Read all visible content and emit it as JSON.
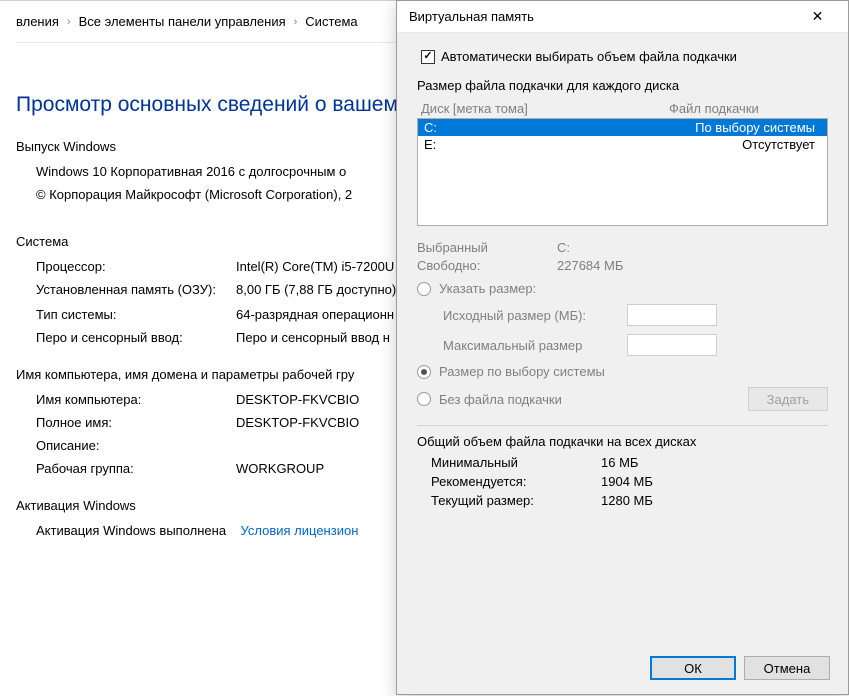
{
  "breadcrumbs": {
    "item0": "вления",
    "item1": "Все элементы панели управления",
    "item2": "Система"
  },
  "heading": "Просмотр основных сведений о вашем ко",
  "edition": {
    "label": "Выпуск Windows",
    "name": "Windows 10 Корпоративная 2016 с долгосрочным о",
    "copyright": "© Корпорация Майкрософт (Microsoft Corporation), 2"
  },
  "system": {
    "label": "Система",
    "cpu_k": "Процессор:",
    "cpu_v": "Intel(R) Core(TM) i5-7200U",
    "ram_k": "Установленная память (ОЗУ):",
    "ram_v": "8,00 ГБ (7,88 ГБ доступно)",
    "type_k": "Тип системы:",
    "type_v": "64-разрядная операционн",
    "pen_k": "Перо и сенсорный ввод:",
    "pen_v": "Перо и сенсорный ввод н"
  },
  "computer": {
    "label": "Имя компьютера, имя домена и параметры рабочей гру",
    "name_k": "Имя компьютера:",
    "name_v": "DESKTOP-FKVCBIO",
    "full_k": "Полное имя:",
    "full_v": "DESKTOP-FKVCBIO",
    "desc_k": "Описание:",
    "desc_v": "",
    "wg_k": "Рабочая группа:",
    "wg_v": "WORKGROUP"
  },
  "activation": {
    "label": "Активация Windows",
    "status": "Активация Windows выполнена",
    "link": "Условия лицензион"
  },
  "dialog": {
    "title": "Виртуальная память",
    "auto": "Автоматически выбирать объем файла подкачки",
    "group_per_drive": "Размер файла подкачки для каждого диска",
    "hdr_drive": "Диск [метка тома]",
    "hdr_file": "Файл подкачки",
    "rows": {
      "r0_d": "C:",
      "r0_f": "По выбору системы",
      "r1_d": "E:",
      "r1_f": "Отсутствует"
    },
    "sel_drive_k": "Выбранный",
    "sel_drive_v": "C:",
    "free_k": "Свободно:",
    "free_v": "227684 МБ",
    "rd_custom": "Указать размер:",
    "initial_k": "Исходный размер (МБ):",
    "max_k": "Максимальный размер",
    "rd_system": "Размер по выбору системы",
    "rd_none": "Без файла подкачки",
    "btn_set": "Задать",
    "group_total": "Общий объем файла подкачки на всех дисках",
    "min_k": "Минимальный",
    "min_v": "16 МБ",
    "rec_k": "Рекомендуется:",
    "rec_v": "1904 МБ",
    "cur_k": "Текущий размер:",
    "cur_v": "1280 МБ",
    "btn_ok": "ОК",
    "btn_cancel": "Отмена"
  }
}
